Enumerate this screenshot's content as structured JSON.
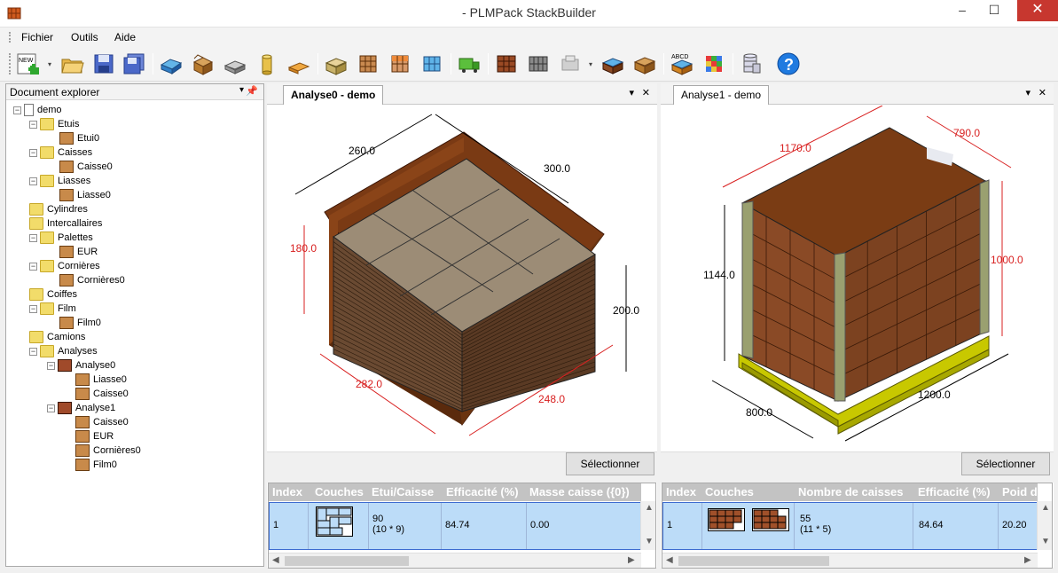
{
  "window": {
    "title": "- PLMPack StackBuilder",
    "minimize_glyph": "–",
    "maximize_glyph": "☐",
    "close_glyph": "✕"
  },
  "menu": [
    "Fichier",
    "Outils",
    "Aide"
  ],
  "toolbar": {
    "new_label": "NEW",
    "dropdown_glyph": "▾",
    "icons": [
      "new-document-icon",
      "open-folder-icon",
      "save-icon",
      "save-all-icon",
      "new-box-icon",
      "new-case-icon",
      "new-bundle-icon",
      "new-cylinder-icon",
      "new-pallet-icon",
      "new-analysis-icon",
      "new-pallet-analysis-icon",
      "new-case-analysis-icon",
      "new-box-layer-icon",
      "new-truck-icon",
      "optimise-icon",
      "new-layer-icon",
      "new-pallet-corner-icon",
      "pack-icon",
      "case-pack-icon",
      "abcd-label-icon",
      "cube-icon",
      "database-icon",
      "help-icon"
    ]
  },
  "explorer": {
    "title": "Document explorer",
    "pin_glyph": "▾",
    "close_glyph": "✕",
    "root": "demo",
    "items": [
      {
        "label": "Etuis",
        "type": "folder",
        "children": [
          "Etui0"
        ]
      },
      {
        "label": "Caisses",
        "type": "folder",
        "children": [
          "Caisse0"
        ]
      },
      {
        "label": "Liasses",
        "type": "folder",
        "children": [
          "Liasse0"
        ]
      },
      {
        "label": "Cylindres",
        "type": "folder",
        "children": []
      },
      {
        "label": "Intercallaires",
        "type": "folder",
        "children": []
      },
      {
        "label": "Palettes",
        "type": "folder",
        "children": [
          "EUR"
        ]
      },
      {
        "label": "Cornières",
        "type": "folder",
        "children": [
          "Cornières0"
        ]
      },
      {
        "label": "Coiffes",
        "type": "folder",
        "children": []
      },
      {
        "label": "Film",
        "type": "folder",
        "children": [
          "Film0"
        ]
      },
      {
        "label": "Camions",
        "type": "folder",
        "children": []
      },
      {
        "label": "Analyses",
        "type": "folder",
        "children": []
      }
    ],
    "analyses": [
      {
        "label": "Analyse0",
        "children": [
          "Liasse0",
          "Caisse0"
        ]
      },
      {
        "label": "Analyse1",
        "children": [
          "Caisse0",
          "EUR",
          "Cornières0",
          "Film0"
        ]
      }
    ]
  },
  "pane0": {
    "tab": "Analyse0 - demo",
    "dims": {
      "d260": "260.0",
      "d300": "300.0",
      "d180": "180.0",
      "d200": "200.0",
      "d282": "282.0",
      "d248": "248.0"
    },
    "button": "Sélectionner",
    "columns": [
      "Index",
      "Couches",
      "Etui/Caisse",
      "Efficacité (%)",
      "Masse caisse ({0})"
    ],
    "row": {
      "index": "1",
      "count": "90",
      "count_detail": "(10 * 9)",
      "efficiency": "84.74",
      "mass": "0.00"
    }
  },
  "pane1": {
    "tab": "Analyse1 - demo",
    "dims": {
      "d1170": "1170.0",
      "d790": "790.0",
      "d1144": "1144.0",
      "d1000": "1000.0",
      "d800": "800.0",
      "d1200": "1200.0"
    },
    "button": "Sélectionner",
    "columns": [
      "Index",
      "Couches",
      "Nombre de caisses",
      "Efficacité (%)",
      "Poid d"
    ],
    "row": {
      "index": "1",
      "count": "55",
      "count_detail": "(11 * 5)",
      "efficiency": "84.64",
      "weight": "20.20"
    }
  },
  "colors": {
    "accent": "#3c6bd0",
    "dim_red": "#d82020",
    "box": "#8b5a3c",
    "pallet": "#c8c800"
  }
}
